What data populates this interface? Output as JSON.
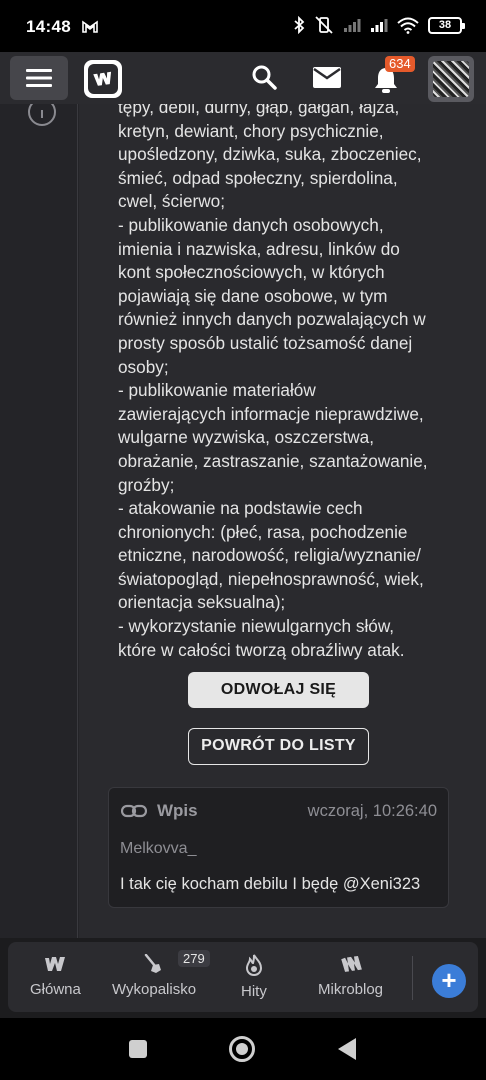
{
  "status_bar": {
    "time": "14:48",
    "battery": "38"
  },
  "header": {
    "notification_count": "634"
  },
  "moderation": {
    "rules_text": "tępy, debil, durny, głąb, gałgan, łajza,\nkretyn, dewiant, chory psychicznie,\nupośledzony, dziwka, suka, zboczeniec,\nśmieć, odpad społeczny, spierdolina,\ncwel, ścierwo;\n- publikowanie danych osobowych,\nimienia i nazwiska, adresu, linków do\nkont społecznościowych, w których\npojawiają się dane osobowe, w tym\nrównież innych danych pozwalających w\nprosty sposób ustalić tożsamość danej\nosoby;\n- publikowanie materiałów\nzawierających informacje nieprawdziwe,\nwulgarne wyzwiska, oszczerstwa,\nobrażanie, zastraszanie, szantażowanie,\ngroźby;\n- atakowanie na podstawie cech\nchronionych: (płeć, rasa, pochodzenie\netniczne, narodowość, religia/wyznanie/\nświatopogląd, niepełnosprawność, wiek,\norientacja seksualna);\n- wykorzystanie niewulgarnych słów,\nktóre w całości tworzą obraźliwy atak.",
    "appeal_button": "ODWOŁAJ SIĘ",
    "back_button": "POWRÓT DO LISTY"
  },
  "entry": {
    "type": "Wpis",
    "time": "wczoraj, 10:26:40",
    "author": "Melkovva_",
    "text": "I tak cię kocham debilu I będę @Xeni323"
  },
  "bottom_nav": {
    "items": [
      {
        "label": "Główna",
        "icon": "home-w-icon"
      },
      {
        "label": "Wykopalisko",
        "icon": "shovel-icon",
        "badge": "279"
      },
      {
        "label": "Hity",
        "icon": "fire-icon"
      },
      {
        "label": "Mikroblog",
        "icon": "microblog-icon"
      }
    ],
    "add_label": "+"
  },
  "colors": {
    "notification_badge": "#e55a2b",
    "add_button": "#3b7dd8"
  }
}
